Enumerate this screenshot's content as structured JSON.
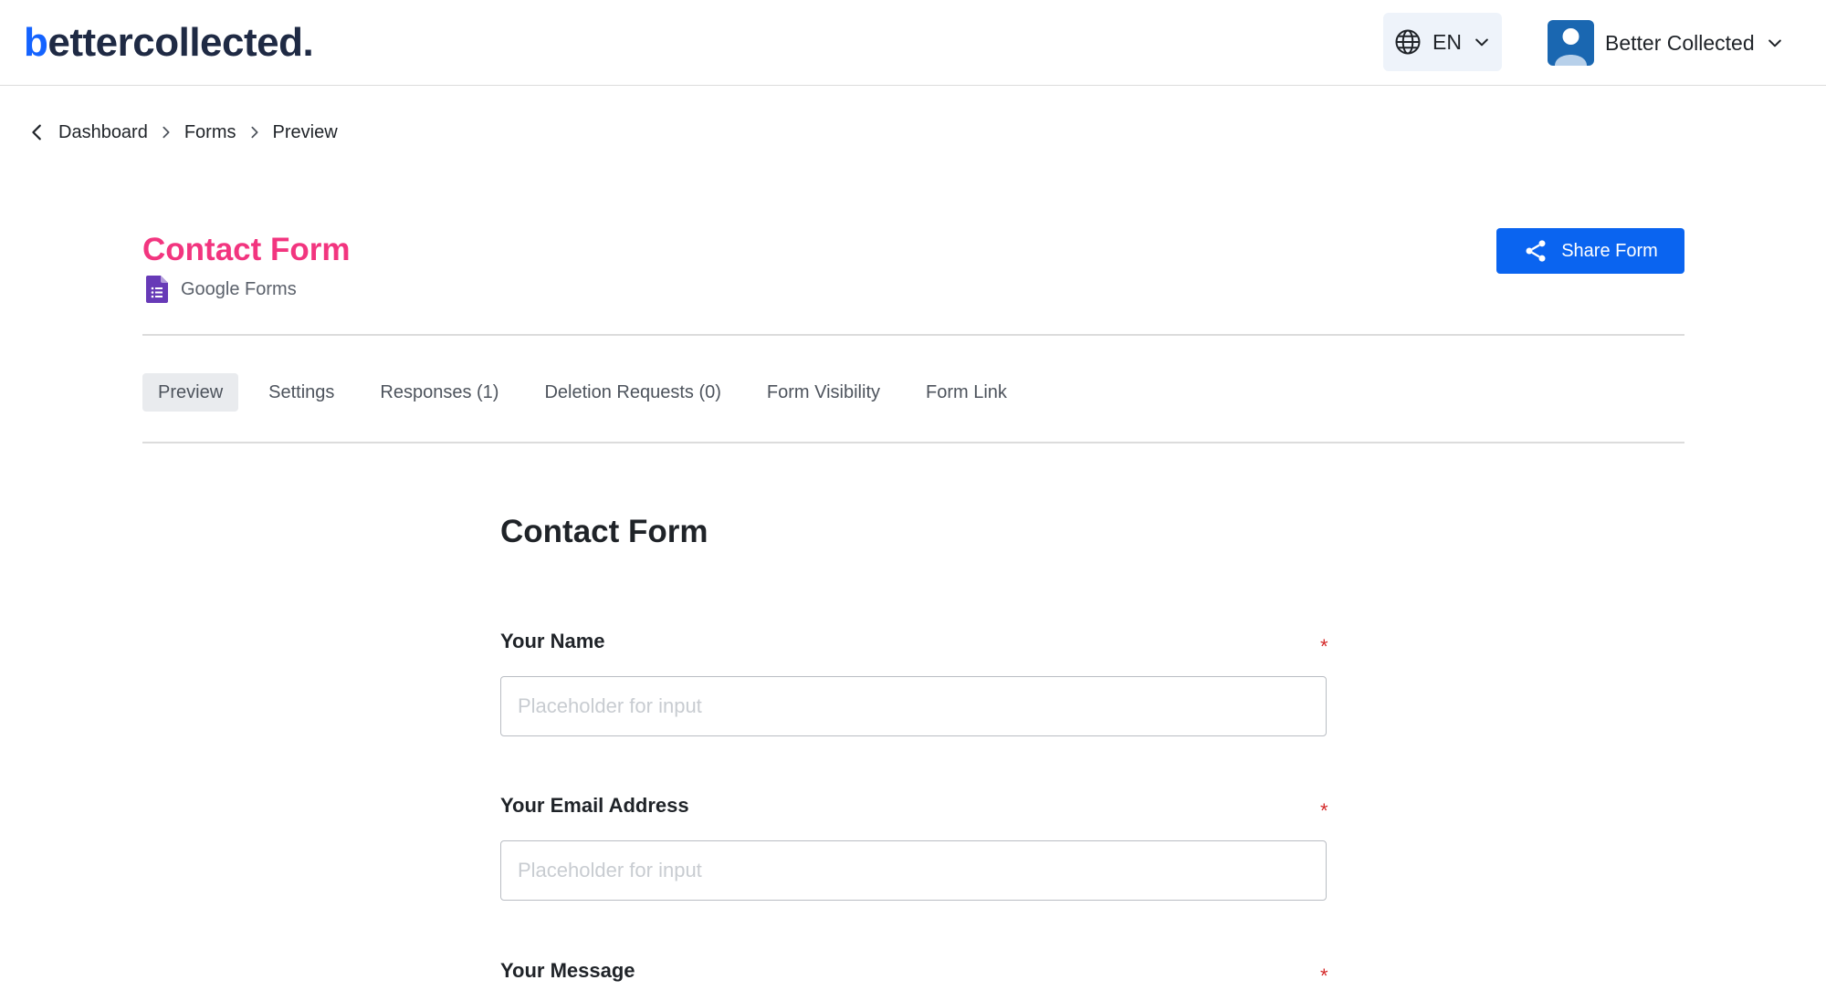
{
  "header": {
    "logo_first": "b",
    "logo_rest": "ettercollected.",
    "language": "EN",
    "user_name": "Better Collected"
  },
  "breadcrumb": {
    "items": [
      "Dashboard",
      "Forms",
      "Preview"
    ]
  },
  "form": {
    "title": "Contact Form",
    "provider": "Google Forms",
    "share_label": "Share Form"
  },
  "tabs": [
    {
      "label": "Preview",
      "active": true
    },
    {
      "label": "Settings",
      "active": false
    },
    {
      "label": "Responses (1)",
      "active": false
    },
    {
      "label": "Deletion Requests (0)",
      "active": false
    },
    {
      "label": "Form Visibility",
      "active": false
    },
    {
      "label": "Form Link",
      "active": false
    }
  ],
  "preview": {
    "heading": "Contact Form",
    "questions": [
      {
        "label": "Your Name",
        "required_mark": "*",
        "placeholder": "Placeholder for input"
      },
      {
        "label": "Your Email Address",
        "required_mark": "*",
        "placeholder": "Placeholder for input"
      },
      {
        "label": "Your Message",
        "required_mark": "*",
        "placeholder": ""
      }
    ]
  },
  "colors": {
    "brand": "#1463ff",
    "title_pink": "#f2357f",
    "primary_button": "#0a64f0",
    "google_forms_purple": "#673ab7",
    "required": "#d42a2a"
  }
}
